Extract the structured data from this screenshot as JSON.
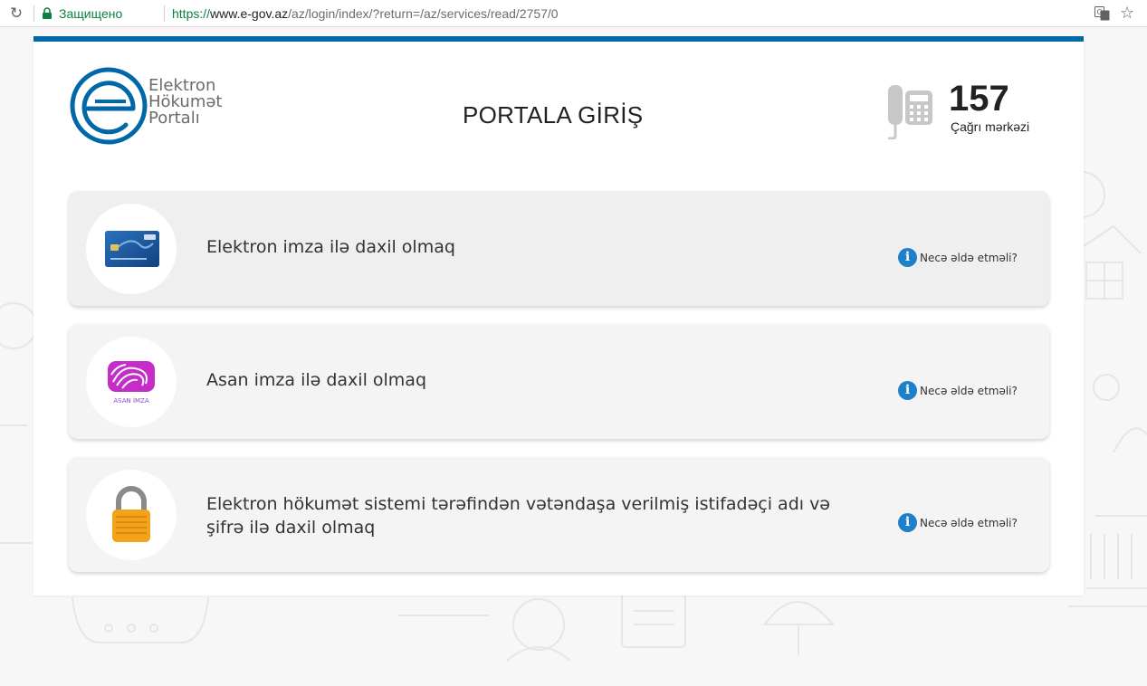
{
  "browser": {
    "secure_label": "Защищено",
    "url_scheme": "https://",
    "url_host": "www.e-gov.az",
    "url_path": "/az/login/index/?return=/az/services/read/2757/0"
  },
  "header": {
    "logo_lines": [
      "Elektron",
      "Hökumət",
      "Portalı"
    ],
    "title": "PORTALA GİRİŞ",
    "call_number": "157",
    "call_label": "Çağrı mərkəzi"
  },
  "options": [
    {
      "label": "Elektron imza ilə daxil olmaq",
      "help": "Necə əldə etməli?",
      "icon": "id-card-icon"
    },
    {
      "label": "Asan imza ilə daxil olmaq",
      "help": "Necə əldə etməli?",
      "icon": "asan-imza-icon",
      "icon_caption": "ASAN İMZA"
    },
    {
      "label": "Elektron hökumət sistemi tərəfindən vətəndaşa verilmiş istifadəçi adı və şifrə ilə daxil olmaq",
      "help": "Necə əldə etməli?",
      "icon": "padlock-icon"
    }
  ],
  "colors": {
    "brand_blue": "#0067a9",
    "secure_green": "#0b8043",
    "info_blue": "#1e80c8",
    "lock_orange": "#f2a31b"
  }
}
